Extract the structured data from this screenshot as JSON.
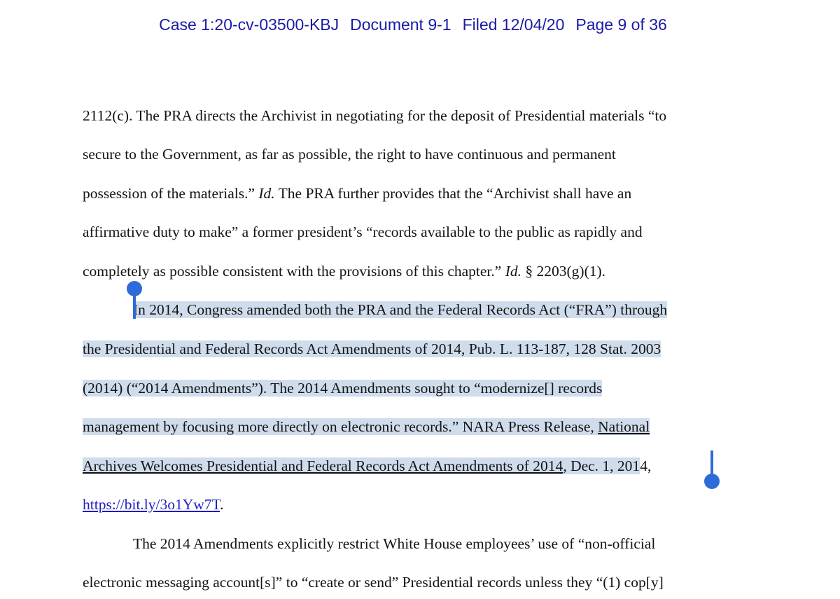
{
  "header": {
    "case": "Case 1:20-cv-03500-KBJ",
    "document": "Document 9-1",
    "filed": "Filed 12/04/20",
    "page": "Page 9 of 36"
  },
  "body": {
    "l1": "2112(c). The PRA directs the Archivist in negotiating for the deposit of Presidential materials “to",
    "l2": "secure to the Government, as far as possible, the right to have continuous and permanent",
    "l3a": "possession of the materials.” ",
    "l3b": "Id.",
    "l3c": " The PRA further provides that the “Archivist shall have an",
    "l4": "affirmative duty to make” a former president’s “records available to the public as rapidly and",
    "l5a": "completely as possible consistent with the provisions of this chapter.” ",
    "l5b": "Id.",
    "l5c": " § 2203(g)(1).",
    "l6": "In 2014, Congress amended both the PRA and the Federal Records Act (“FRA”) through",
    "l7": "the Presidential and Federal Records Act Amendments of 2014, Pub. L. 113-187, 128 Stat. 2003",
    "l8": "(2014) (“2014 Amendments”). The 2014 Amendments sought to “modernize[] records",
    "l9a": "management by focusing more directly on electronic records.” NARA Press Release, ",
    "l9b": "National",
    "l10a": "Archives Welcomes Presidential and Federal Records Act Amendments of 2014",
    "l10b": ", Dec. 1, 201",
    "l10c": "4,",
    "l11a": "https://bit.ly/3o1Yw7T",
    "l11b": ".",
    "l12": "The 2014 Amendments explicitly restrict White House employees’ use of “non-official",
    "l13": "electronic messaging account[s]” to “create or send” Presidential records unless they “(1) cop[y]"
  },
  "selection": {
    "color": "#cfdcec",
    "handle_color": "#2f6ad9"
  }
}
